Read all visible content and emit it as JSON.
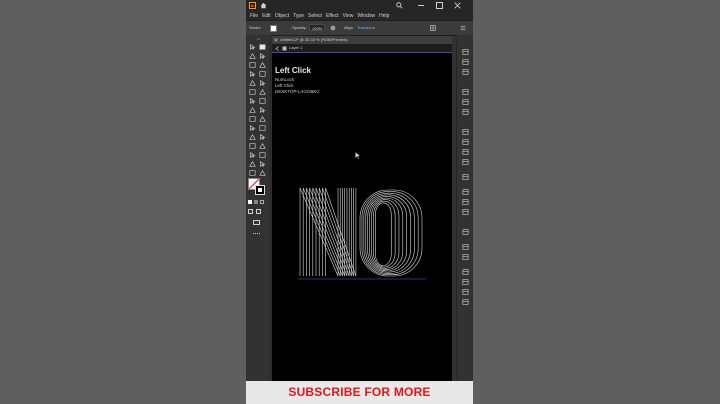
{
  "app": {
    "name": "Ai"
  },
  "menu": [
    "File",
    "Edit",
    "Object",
    "Type",
    "Select",
    "Effect",
    "View",
    "Window",
    "Help"
  ],
  "control_bar": {
    "fill_label": "Stroke",
    "opacity_label": "Opacity:",
    "opacity_value": "100%",
    "align_label": "Align",
    "transform_label": "Transform"
  },
  "document": {
    "tab_title": "Untitled-2* @ 33.33 % (RGB/Preview)",
    "layer_name": "Layer 1"
  },
  "key_overlay": {
    "action": "Left Click",
    "lines": [
      "NumLock",
      "Left Click",
      "DESKTOP-LAGOBKC"
    ]
  },
  "artwork": {
    "text": "NO"
  },
  "banner": {
    "text": "SUBSCRIBE FOR MORE"
  },
  "colors": {
    "accent": "#e0161c",
    "artboard": "#000000",
    "ui": "#323232"
  }
}
